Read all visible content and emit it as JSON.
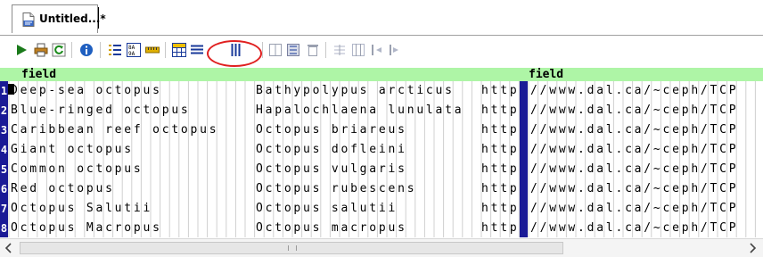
{
  "tab": {
    "title": "Untitled...*",
    "icon": "xml-file-icon"
  },
  "toolbar": {
    "buttons": [
      {
        "name": "run-icon",
        "color": "#1a7a1a"
      },
      {
        "name": "print-icon",
        "color": "#c08020"
      },
      {
        "name": "refresh-icon",
        "color": "#1a8a1a"
      },
      {
        "name": "info-icon",
        "color": "#1f5fc0"
      },
      {
        "name": "list-view-icon",
        "color": "#d0a000"
      },
      {
        "name": "column-sort-icon",
        "color": "#1a1a1a"
      },
      {
        "name": "ruler-icon",
        "color": "#e0b000"
      },
      {
        "name": "grid-view-icon",
        "color": "#1a3a9a"
      },
      {
        "name": "row-lines-icon",
        "color": "#1a3a9a"
      },
      {
        "name": "column-lines-icon",
        "color": "#1a3a9a"
      },
      {
        "name": "split-columns-icon",
        "color": "#9aa0b0"
      },
      {
        "name": "merge-columns-icon",
        "color": "#9aa0b0"
      },
      {
        "name": "delete-column-icon",
        "color": "#9aa0b0"
      },
      {
        "name": "insert-row-icon",
        "color": "#9aa0b0"
      },
      {
        "name": "insert-column-icon",
        "color": "#9aa0b0"
      },
      {
        "name": "move-left-icon",
        "color": "#9aa0b0"
      },
      {
        "name": "move-right-icon",
        "color": "#9aa0b0"
      }
    ],
    "highlight_color": "#e02020"
  },
  "grid": {
    "header_color": "#aef5a6",
    "gutter_color": "#1a1a96",
    "headers": [
      {
        "label": "field"
      },
      {
        "label": "field"
      }
    ],
    "rows": [
      {
        "num": "1",
        "common": "Deep-sea octopus",
        "scientific": "Bathypolypus arcticus",
        "url_left": "http",
        "url_right": "//www.dal.ca/~ceph/TCP"
      },
      {
        "num": "2",
        "common": "Blue-ringed octopus",
        "scientific": "Hapalochlaena lunulata",
        "url_left": "http",
        "url_right": "//www.dal.ca/~ceph/TCP"
      },
      {
        "num": "3",
        "common": "Caribbean reef octopus",
        "scientific": "Octopus briareus",
        "url_left": "http",
        "url_right": "//www.dal.ca/~ceph/TCP"
      },
      {
        "num": "4",
        "common": "Giant octopus",
        "scientific": "Octopus dofleini",
        "url_left": "http",
        "url_right": "//www.dal.ca/~ceph/TCP"
      },
      {
        "num": "5",
        "common": "Common octopus",
        "scientific": "Octopus vulgaris",
        "url_left": "http",
        "url_right": "//www.dal.ca/~ceph/TCP"
      },
      {
        "num": "6",
        "common": "Red octopus",
        "scientific": "Octopus rubescens",
        "url_left": "http",
        "url_right": "//www.dal.ca/~ceph/TCP"
      },
      {
        "num": "7",
        "common": "Octopus Salutii",
        "scientific": "Octopus salutii",
        "url_left": "http",
        "url_right": "//www.dal.ca/~ceph/TCP"
      },
      {
        "num": "8",
        "common": "Octopus Macropus",
        "scientific": "Octopus macropus",
        "url_left": "http",
        "url_right": "//www.dal.ca/~ceph/TCP"
      }
    ]
  },
  "scrollbar": {
    "left_icon": "scroll-left-icon",
    "right_icon": "scroll-right-icon"
  }
}
